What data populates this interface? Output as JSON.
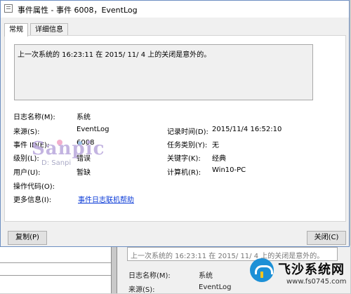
{
  "dialog": {
    "title": "事件属性 - 事件 6008，EventLog",
    "tabs": [
      {
        "label": "常规",
        "active": true
      },
      {
        "label": "详细信息",
        "active": false
      }
    ],
    "description": "上一次系统的 16:23:11 在    2015/   11/   4 上的关闭是意外的。",
    "fields": {
      "log_name": {
        "label": "日志名称(M):",
        "value": "系统"
      },
      "source": {
        "label": "来源(S):",
        "value": "EventLog"
      },
      "logged": {
        "label": "记录时间(D):",
        "value": "2015/11/4 16:52:10"
      },
      "event_id": {
        "label": "事件 ID(E):",
        "value": "6008"
      },
      "task_category": {
        "label": "任务类别(Y):",
        "value": "无"
      },
      "level": {
        "label": "级别(L):",
        "value": "错误"
      },
      "keywords": {
        "label": "关键字(K):",
        "value": "经典"
      },
      "user": {
        "label": "用户(U):",
        "value": "暂缺"
      },
      "computer": {
        "label": "计算机(R):",
        "value": "Win10-PC"
      },
      "opcode": {
        "label": "操作代码(O):",
        "value": ""
      },
      "more_info": {
        "label": "更多信息(I):",
        "link": "事件日志联机帮助"
      }
    },
    "buttons": {
      "copy": "复制(P)",
      "close": "关闭(C)"
    }
  },
  "watermark": {
    "text": "Sanpic",
    "sub": "D: Sanpi"
  },
  "background_window": {
    "description": "上一次系统的 16:23:11 在    2015/   11/   4 上的关闭是意外的。",
    "rows": [
      {
        "label": "日志名称(M):",
        "value": "系统"
      },
      {
        "label": "来源(S):",
        "value": "EventLog"
      }
    ],
    "side_buttons": [
      "up-arrow",
      "down-arrow"
    ]
  },
  "site_logo": {
    "name": "飞沙系统网",
    "url": "www.fs0745.com",
    "colors": {
      "mark": "#1d90d6",
      "accent": "#f7c51e"
    }
  }
}
